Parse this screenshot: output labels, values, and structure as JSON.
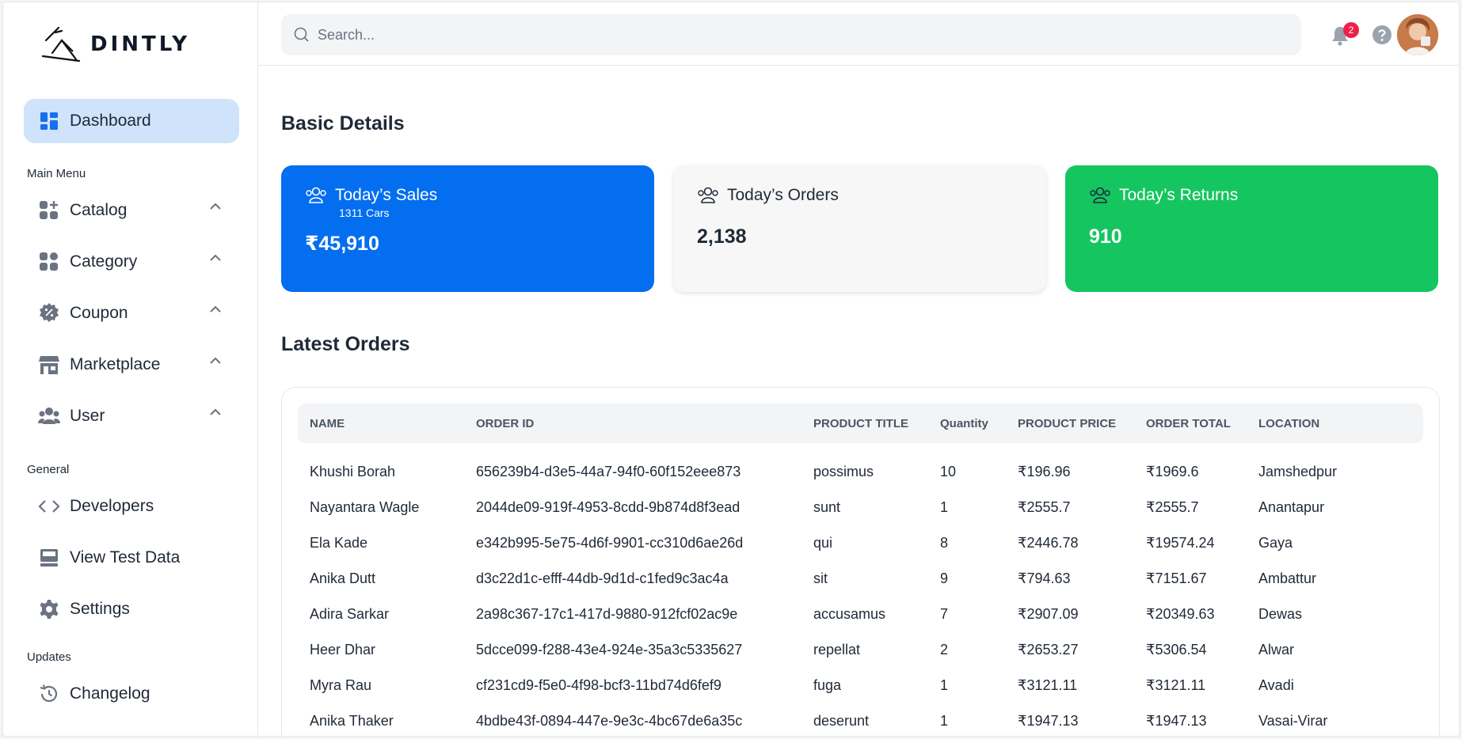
{
  "brand": {
    "name": "DINTLY"
  },
  "sidebar": {
    "dashboard": "Dashboard",
    "main_menu_label": "Main Menu",
    "main_menu": [
      {
        "label": "Catalog",
        "icon": "catalog-icon"
      },
      {
        "label": "Category",
        "icon": "category-icon"
      },
      {
        "label": "Coupon",
        "icon": "coupon-icon"
      },
      {
        "label": "Marketplace",
        "icon": "store-icon"
      },
      {
        "label": "User",
        "icon": "users-icon"
      }
    ],
    "general_label": "General",
    "general": [
      {
        "label": "Developers",
        "icon": "code-icon"
      },
      {
        "label": "View Test Data",
        "icon": "inbox-icon"
      },
      {
        "label": "Settings",
        "icon": "gear-icon"
      }
    ],
    "updates_label": "Updates",
    "updates": [
      {
        "label": "Changelog",
        "icon": "history-icon"
      }
    ]
  },
  "topbar": {
    "search_placeholder": "Search...",
    "notification_count": "2"
  },
  "basic_details": {
    "title": "Basic Details",
    "sales": {
      "label": "Today’s Sales",
      "sub": "1311 Cars",
      "value": "₹45,910",
      "color": "#046ef0"
    },
    "orders": {
      "label": "Today’s Orders",
      "value": "2,138",
      "color": "#f7f7f7"
    },
    "returns": {
      "label": "Today’s Returns",
      "value": "910",
      "color": "#15c660"
    }
  },
  "latest_orders": {
    "title": "Latest Orders",
    "columns": [
      "NAME",
      "ORDER ID",
      "PRODUCT TITLE",
      "Quantity",
      "PRODUCT PRICE",
      "ORDER TOTAL",
      "LOCATION"
    ],
    "rows": [
      [
        "Khushi Borah",
        "656239b4-d3e5-44a7-94f0-60f152eee873",
        "possimus",
        "10",
        "₹196.96",
        "₹1969.6",
        "Jamshedpur"
      ],
      [
        "Nayantara Wagle",
        "2044de09-919f-4953-8cdd-9b874d8f3ead",
        "sunt",
        "1",
        "₹2555.7",
        "₹2555.7",
        "Anantapur"
      ],
      [
        "Ela Kade",
        "e342b995-5e75-4d6f-9901-cc310d6ae26d",
        "qui",
        "8",
        "₹2446.78",
        "₹19574.24",
        "Gaya"
      ],
      [
        "Anika Dutt",
        "d3c22d1c-efff-44db-9d1d-c1fed9c3ac4a",
        "sit",
        "9",
        "₹794.63",
        "₹7151.67",
        "Ambattur"
      ],
      [
        "Adira Sarkar",
        "2a98c367-17c1-417d-9880-912fcf02ac9e",
        "accusamus",
        "7",
        "₹2907.09",
        "₹20349.63",
        "Dewas"
      ],
      [
        "Heer Dhar",
        "5dcce099-f288-43e4-924e-35a3c5335627",
        "repellat",
        "2",
        "₹2653.27",
        "₹5306.54",
        "Alwar"
      ],
      [
        "Myra Rau",
        "cf231cd9-f5e0-4f98-bcf3-11bd74d6fef9",
        "fuga",
        "1",
        "₹3121.11",
        "₹3121.11",
        "Avadi"
      ],
      [
        "Anika Thaker",
        "4bdbe43f-0894-447e-9e3c-4bc67de6a35c",
        "deserunt",
        "1",
        "₹1947.13",
        "₹1947.13",
        "Vasai-Virar"
      ]
    ]
  }
}
